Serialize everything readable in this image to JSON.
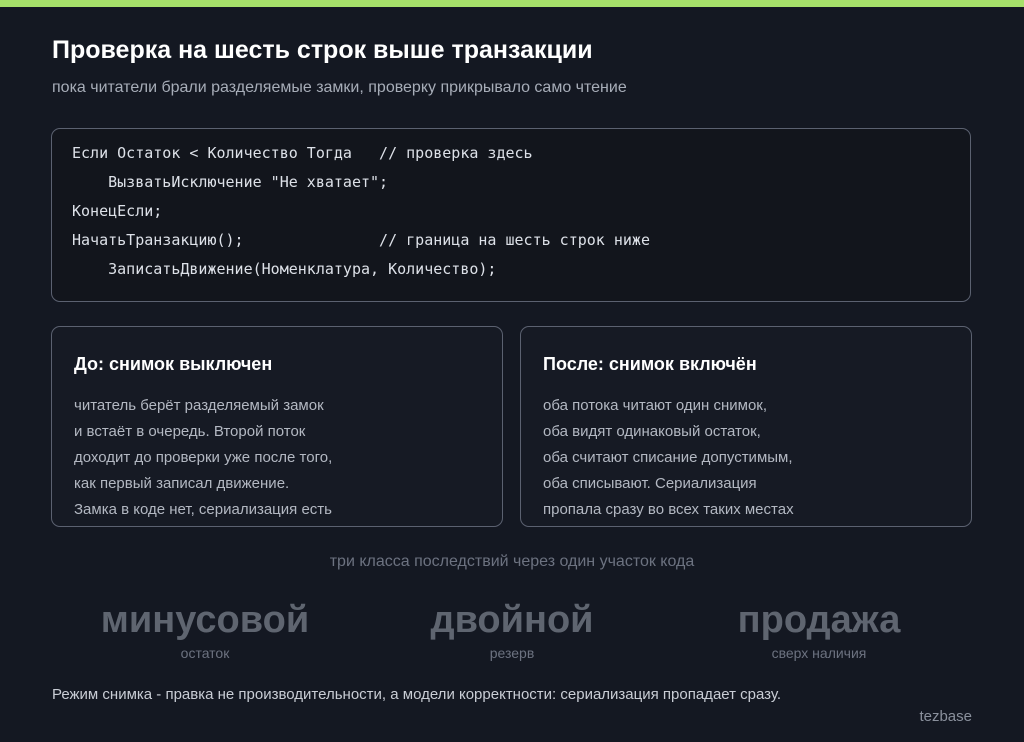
{
  "colors": {
    "accent": "#a6e06a",
    "background": "#141822"
  },
  "header": {
    "title": "Проверка на шесть строк выше транзакции",
    "subtitle": "пока читатели брали разделяемые замки, проверку прикрывало само чтение"
  },
  "code": {
    "lines": [
      "Если Остаток < Количество Тогда   // проверка здесь",
      "    ВызватьИсключение \"Не хватает\";",
      "КонецЕсли;",
      "НачатьТранзакцию();               // граница на шесть строк ниже",
      "    ЗаписатьДвижение(Номенклатура, Количество);"
    ]
  },
  "before": {
    "title": "До: снимок выключен",
    "lines": [
      "читатель берёт разделяемый замок",
      "и встаёт в очередь. Второй поток",
      "доходит до проверки уже после того,",
      "как первый записал движение.",
      "Замка в коде нет, сериализация есть"
    ]
  },
  "after": {
    "title": "После: снимок включён",
    "lines": [
      "оба потока читают один снимок,",
      "оба видят одинаковый остаток,",
      "оба считают списание допустимым,",
      "оба списывают. Сериализация",
      "пропала сразу во всех таких местах"
    ]
  },
  "consequences": {
    "caption": "три класса последствий через один участок кода",
    "items": [
      {
        "big": "минусовой",
        "small": "остаток"
      },
      {
        "big": "двойной",
        "small": "резерв"
      },
      {
        "big": "продажа",
        "small": "сверх наличия"
      }
    ]
  },
  "footer": {
    "note": "Режим снимка - правка не производительности, а модели корректности: сериализация пропадает сразу.",
    "brand": "tezbase"
  }
}
